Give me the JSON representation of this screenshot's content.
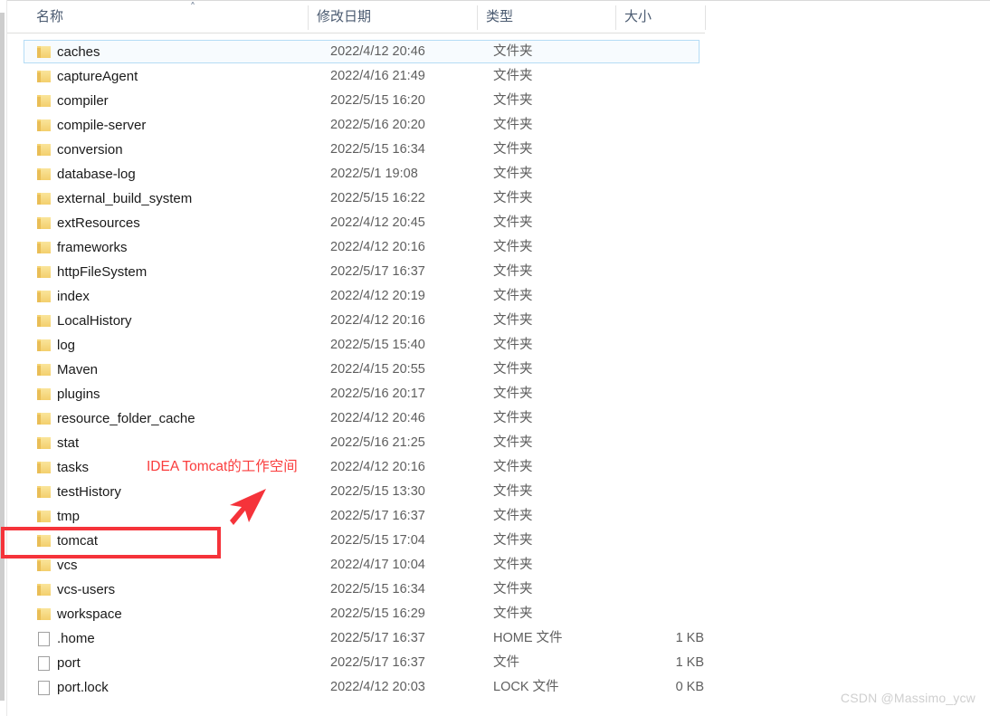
{
  "window": {
    "app": "Windows File Explorer",
    "view": "details"
  },
  "columns": {
    "name": "名称",
    "date_modified": "修改日期",
    "type": "类型",
    "size": "大小",
    "sort_indicator": "˄",
    "sorted_by": "名称",
    "sort_direction": "ascending"
  },
  "rows": [
    {
      "icon": "folder-icon",
      "name": "caches",
      "date": "2022/4/12 20:46",
      "type": "文件夹",
      "size": "",
      "selected": true
    },
    {
      "icon": "folder-icon",
      "name": "captureAgent",
      "date": "2022/4/16 21:49",
      "type": "文件夹",
      "size": "",
      "selected": false
    },
    {
      "icon": "folder-icon",
      "name": "compiler",
      "date": "2022/5/15 16:20",
      "type": "文件夹",
      "size": "",
      "selected": false
    },
    {
      "icon": "folder-icon",
      "name": "compile-server",
      "date": "2022/5/16 20:20",
      "type": "文件夹",
      "size": "",
      "selected": false
    },
    {
      "icon": "folder-icon",
      "name": "conversion",
      "date": "2022/5/15 16:34",
      "type": "文件夹",
      "size": "",
      "selected": false
    },
    {
      "icon": "folder-icon",
      "name": "database-log",
      "date": "2022/5/1 19:08",
      "type": "文件夹",
      "size": "",
      "selected": false
    },
    {
      "icon": "folder-icon",
      "name": "external_build_system",
      "date": "2022/5/15 16:22",
      "type": "文件夹",
      "size": "",
      "selected": false
    },
    {
      "icon": "folder-icon",
      "name": "extResources",
      "date": "2022/4/12 20:45",
      "type": "文件夹",
      "size": "",
      "selected": false
    },
    {
      "icon": "folder-icon",
      "name": "frameworks",
      "date": "2022/4/12 20:16",
      "type": "文件夹",
      "size": "",
      "selected": false
    },
    {
      "icon": "folder-icon",
      "name": "httpFileSystem",
      "date": "2022/5/17 16:37",
      "type": "文件夹",
      "size": "",
      "selected": false
    },
    {
      "icon": "folder-icon",
      "name": "index",
      "date": "2022/4/12 20:19",
      "type": "文件夹",
      "size": "",
      "selected": false
    },
    {
      "icon": "folder-icon",
      "name": "LocalHistory",
      "date": "2022/4/12 20:16",
      "type": "文件夹",
      "size": "",
      "selected": false
    },
    {
      "icon": "folder-icon",
      "name": "log",
      "date": "2022/5/15 15:40",
      "type": "文件夹",
      "size": "",
      "selected": false
    },
    {
      "icon": "folder-icon",
      "name": "Maven",
      "date": "2022/4/15 20:55",
      "type": "文件夹",
      "size": "",
      "selected": false
    },
    {
      "icon": "folder-icon",
      "name": "plugins",
      "date": "2022/5/16 20:17",
      "type": "文件夹",
      "size": "",
      "selected": false
    },
    {
      "icon": "folder-icon",
      "name": "resource_folder_cache",
      "date": "2022/4/12 20:46",
      "type": "文件夹",
      "size": "",
      "selected": false
    },
    {
      "icon": "folder-icon",
      "name": "stat",
      "date": "2022/5/16 21:25",
      "type": "文件夹",
      "size": "",
      "selected": false
    },
    {
      "icon": "folder-icon",
      "name": "tasks",
      "date": "2022/4/12 20:16",
      "type": "文件夹",
      "size": "",
      "selected": false
    },
    {
      "icon": "folder-icon",
      "name": "testHistory",
      "date": "2022/5/15 13:30",
      "type": "文件夹",
      "size": "",
      "selected": false
    },
    {
      "icon": "folder-icon",
      "name": "tmp",
      "date": "2022/5/17 16:37",
      "type": "文件夹",
      "size": "",
      "selected": false
    },
    {
      "icon": "folder-icon",
      "name": "tomcat",
      "date": "2022/5/15 17:04",
      "type": "文件夹",
      "size": "",
      "selected": false
    },
    {
      "icon": "folder-icon",
      "name": "vcs",
      "date": "2022/4/17 10:04",
      "type": "文件夹",
      "size": "",
      "selected": false
    },
    {
      "icon": "folder-icon",
      "name": "vcs-users",
      "date": "2022/5/15 16:34",
      "type": "文件夹",
      "size": "",
      "selected": false
    },
    {
      "icon": "folder-icon",
      "name": "workspace",
      "date": "2022/5/15 16:29",
      "type": "文件夹",
      "size": "",
      "selected": false
    },
    {
      "icon": "file-icon",
      "name": ".home",
      "date": "2022/5/17 16:37",
      "type": "HOME 文件",
      "size": "1 KB",
      "selected": false
    },
    {
      "icon": "file-icon",
      "name": "port",
      "date": "2022/5/17 16:37",
      "type": "文件",
      "size": "1 KB",
      "selected": false
    },
    {
      "icon": "file-icon",
      "name": "port.lock",
      "date": "2022/4/12 20:03",
      "type": "LOCK 文件",
      "size": "0 KB",
      "selected": false
    }
  ],
  "annotations": {
    "note_text": "IDEA Tomcat的工作空间",
    "note_color": "#fa3c3c",
    "highlight_target": "tomcat",
    "highlight_color": "#f5333a",
    "arrow": "arrow-down-left"
  },
  "watermark": {
    "text": "CSDN @Massimo_ycw",
    "color": "#cfcfcf"
  }
}
